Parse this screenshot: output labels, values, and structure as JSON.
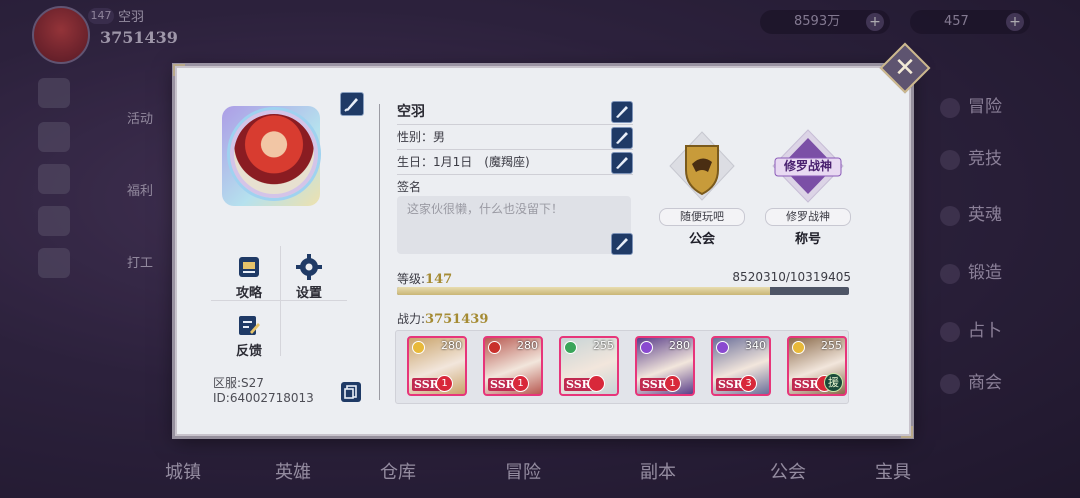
{
  "background": {
    "player_level": "147",
    "player_name": "空羽",
    "player_power": "3751439",
    "gold": "8593万",
    "gems": "457",
    "left_features": [
      "活动",
      "福利",
      "打工"
    ],
    "right_menu": [
      "冒险",
      "竞技",
      "英魂",
      "锻造",
      "占卜",
      "商会"
    ],
    "bottom_nav": [
      "城镇",
      "英雄",
      "仓库",
      "冒险",
      "副本",
      "公会",
      "宝具"
    ]
  },
  "profile": {
    "name": "空羽",
    "gender": "性别：男",
    "birthday": "生日：1月1日　(魔羯座)",
    "signature_label": "签名",
    "signature_placeholder": "这家伙很懒，什么也没留下！",
    "server": "区服:S27",
    "id": "ID:64002718013",
    "level_label": "等级:",
    "level": "147",
    "exp_text": "8520310/10319405",
    "exp_current": 8520310,
    "exp_max": 10319405,
    "power_label": "战力:",
    "power": "3751439"
  },
  "functions": {
    "guide": "攻略",
    "settings": "设置",
    "feedback": "反馈"
  },
  "badges": {
    "guild_name": "随便玩吧",
    "guild_title": "公会",
    "rank_emblem": "修罗战神",
    "rank_name": "修罗战神",
    "rank_title": "称号"
  },
  "team": [
    {
      "level": "280",
      "rarity": "SSR",
      "stars": "1",
      "element_color": "#e8b93a",
      "tint": "#c9a36a"
    },
    {
      "level": "280",
      "rarity": "SSR",
      "stars": "1",
      "element_color": "#c9302c",
      "tint": "#b85a52"
    },
    {
      "level": "255",
      "rarity": "SSR",
      "stars": "",
      "element_color": "#3aa55a",
      "tint": "#c7d4d6"
    },
    {
      "level": "280",
      "rarity": "SSR",
      "stars": "1",
      "element_color": "#8a4ad0",
      "tint": "#5a3f8a"
    },
    {
      "level": "340",
      "rarity": "SSR",
      "stars": "3",
      "element_color": "#8a4ad0",
      "tint": "#6a6f9a"
    },
    {
      "level": "255",
      "rarity": "SSR",
      "stars": "",
      "element_color": "#e8b93a",
      "tint": "#8a6a4a",
      "assist": "援"
    }
  ]
}
